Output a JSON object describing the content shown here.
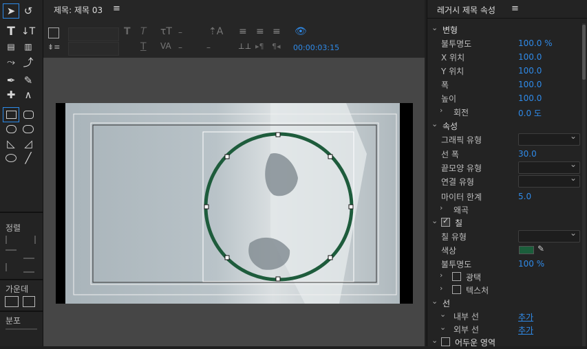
{
  "tools": {
    "groups": {
      "align": "정렬",
      "distribute": "가운데",
      "distribute2": "분포"
    }
  },
  "editor": {
    "tab_title": "제목: 제목 03",
    "menu_glyph": "≡",
    "timecode": "00:00:03:15"
  },
  "props": {
    "title": "레거시 제목 속성",
    "menu_glyph": "≡",
    "sections": {
      "transform": "변형",
      "properties": "속성",
      "fill": "칠",
      "stroke": "선",
      "shadow": "어두운 영역"
    },
    "transform": {
      "opacity_label": "불투명도",
      "opacity": "100.0 %",
      "x_label": "X 위치",
      "x": "100.0",
      "y_label": "Y 위치",
      "y": "100.0",
      "width_label": "폭",
      "width": "100.0",
      "height_label": "높이",
      "height": "100.0",
      "rotation_label": "회전",
      "rotation": "0.0 도"
    },
    "properties": {
      "graphic_type_label": "그래픽 유형",
      "line_width_label": "선 폭",
      "line_width": "30.0",
      "cap_type_label": "끝모양 유형",
      "join_type_label": "연결 유형",
      "miter_label": "마이터 한계",
      "miter": "5.0",
      "distort_label": "왜곡"
    },
    "fill": {
      "fill_type_label": "칠 유형",
      "color_label": "색상",
      "color": "#1b5e3b",
      "opacity_label": "불투명도",
      "opacity": "100 %",
      "sheen_label": "광택",
      "texture_label": "텍스처"
    },
    "stroke": {
      "inner_label": "내부 선",
      "inner_add": "추가",
      "outer_label": "외부 선",
      "outer_add": "추가"
    }
  },
  "canvas": {
    "ring_color": "#1e5c3c"
  }
}
